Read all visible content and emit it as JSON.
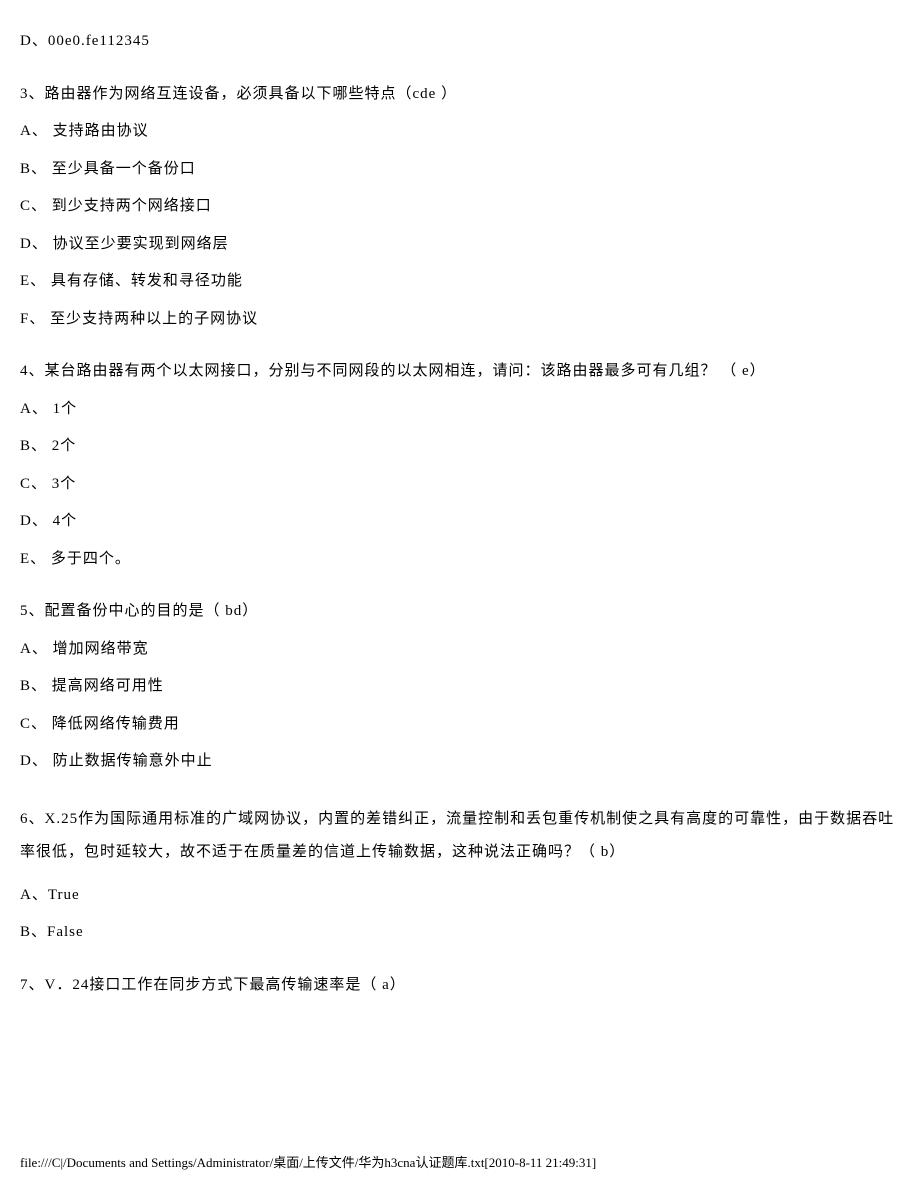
{
  "q2": {
    "optD": "D、00e0.fe112345"
  },
  "q3": {
    "stem": "3、路由器作为网络互连设备，必须具备以下哪些特点（cde ）",
    "optA": "A、  支持路由协议",
    "optB": "B、  至少具备一个备份口",
    "optC": "C、  到少支持两个网络接口",
    "optD": "D、  协议至少要实现到网络层",
    "optE": "E、  具有存储、转发和寻径功能",
    "optF": "F、  至少支持两种以上的子网协议"
  },
  "q4": {
    "stem": "4、某台路由器有两个以太网接口，分别与不同网段的以太网相连，请问：该路由器最多可有几组？ （ e）",
    "optA": "A、  1个",
    "optB": "B、  2个",
    "optC": "C、  3个",
    "optD": "D、  4个",
    "optE": "E、  多于四个。"
  },
  "q5": {
    "stem": "5、配置备份中心的目的是（ bd）",
    "optA": "A、  增加网络带宽",
    "optB": "B、  提高网络可用性",
    "optC": "C、  降低网络传输费用",
    "optD": "D、  防止数据传输意外中止"
  },
  "q6": {
    "stem": "6、X.25作为国际通用标准的广域网协议，内置的差错纠正，流量控制和丢包重传机制使之具有高度的可靠性，由于数据吞吐率很低，包时延较大，故不适于在质量差的信道上传输数据，这种说法正确吗？（ b）",
    "optA": "A、True",
    "optB": "B、False"
  },
  "q7": {
    "stem": "7、V．24接口工作在同步方式下最高传输速率是（ a）"
  },
  "footer": "file:///C|/Documents and Settings/Administrator/桌面/上传文件/华为h3cna认证题库.txt[2010-8-11 21:49:31]"
}
